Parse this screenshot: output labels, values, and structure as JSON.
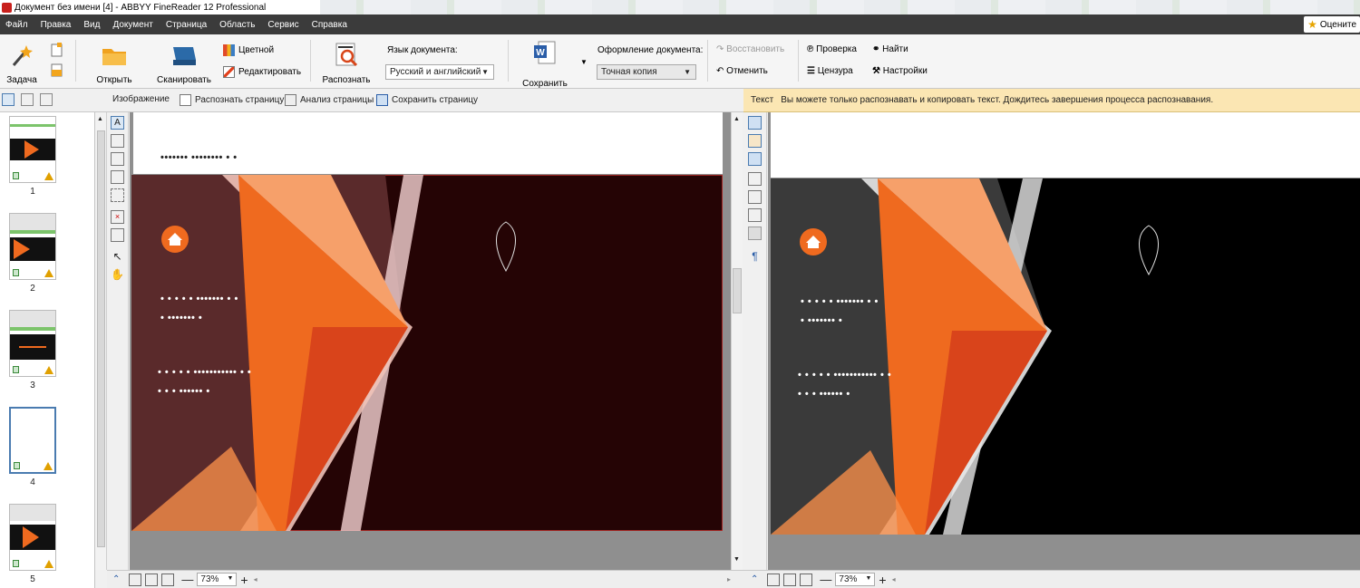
{
  "titlebar": {
    "title": "Документ без имени [4] - ABBYY FineReader 12 Professional"
  },
  "menu": {
    "items": [
      "Файл",
      "Правка",
      "Вид",
      "Документ",
      "Страница",
      "Область",
      "Сервис",
      "Справка"
    ],
    "rate_label": "Оцените"
  },
  "ribbon": {
    "task": "Задача",
    "open": "Открыть",
    "scan": "Сканировать",
    "color": "Цветной",
    "edit": "Редактировать",
    "recognize": "Распознать",
    "doc_lang_label": "Язык документа:",
    "doc_lang_value": "Русский и английский",
    "save": "Сохранить",
    "layout_label": "Оформление документа:",
    "layout_value": "Точная копия",
    "restore": "Восстановить",
    "cancel": "Отменить",
    "check": "Проверка",
    "censor": "Цензура",
    "find": "Найти",
    "settings": "Настройки"
  },
  "subbar": {
    "image_label": "Изображение",
    "recognize_page": "Распознать страницу",
    "analyze_page": "Анализ страницы",
    "save_page": "Сохранить страницу"
  },
  "text_notice": {
    "label": "Текст",
    "message": "Вы можете только распознавать и копировать текст. Дождитесь завершения процесса распознавания."
  },
  "thumbnails": [
    {
      "num": "1"
    },
    {
      "num": "2"
    },
    {
      "num": "3"
    },
    {
      "num": "4"
    },
    {
      "num": "5"
    }
  ],
  "slide": {
    "header_dots": "•••••••  ••••••••  • •",
    "line1": "• • • •  • •••••••  • •",
    "line2": "• •••••••  •",
    "line3": "• • • •  • •••••••••••  • •",
    "line4": "• • • ••••••  •"
  },
  "status": {
    "zoom_left": "73%",
    "zoom_right": "73%"
  },
  "colors": {
    "menubar": "#3b3b3b",
    "notice": "#fbe6b3",
    "slide_bg_left": "#250405",
    "slide_bg_right": "#000000",
    "accent": "#ef6a1f"
  }
}
